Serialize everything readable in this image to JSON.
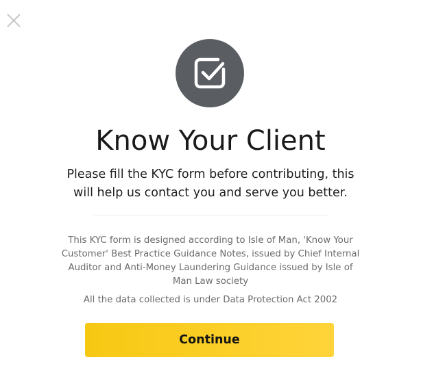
{
  "dialog": {
    "close_icon": "close-icon",
    "badge_icon": "checkbox-check-icon",
    "title": "Know Your Client",
    "subtitle": "Please fill the KYC form before contributing, this will help us contact you and serve you better.",
    "note": "This KYC form is designed according to Isle of Man, 'Know Your Customer' Best Practice Guidance Notes, issued by Chief Internal Auditor and Anti-Money Laundering Guidance issued by Isle of Man Law society",
    "data_protection": "All the data collected is under Data Protection Act 2002",
    "continue_label": "Continue"
  },
  "colors": {
    "badge_bg": "#5a5d62",
    "button_bg": "#f9cb1c",
    "title_text": "#1a1a1a",
    "muted_text": "#6b6b6b",
    "close_icon": "#c8c8c8"
  }
}
